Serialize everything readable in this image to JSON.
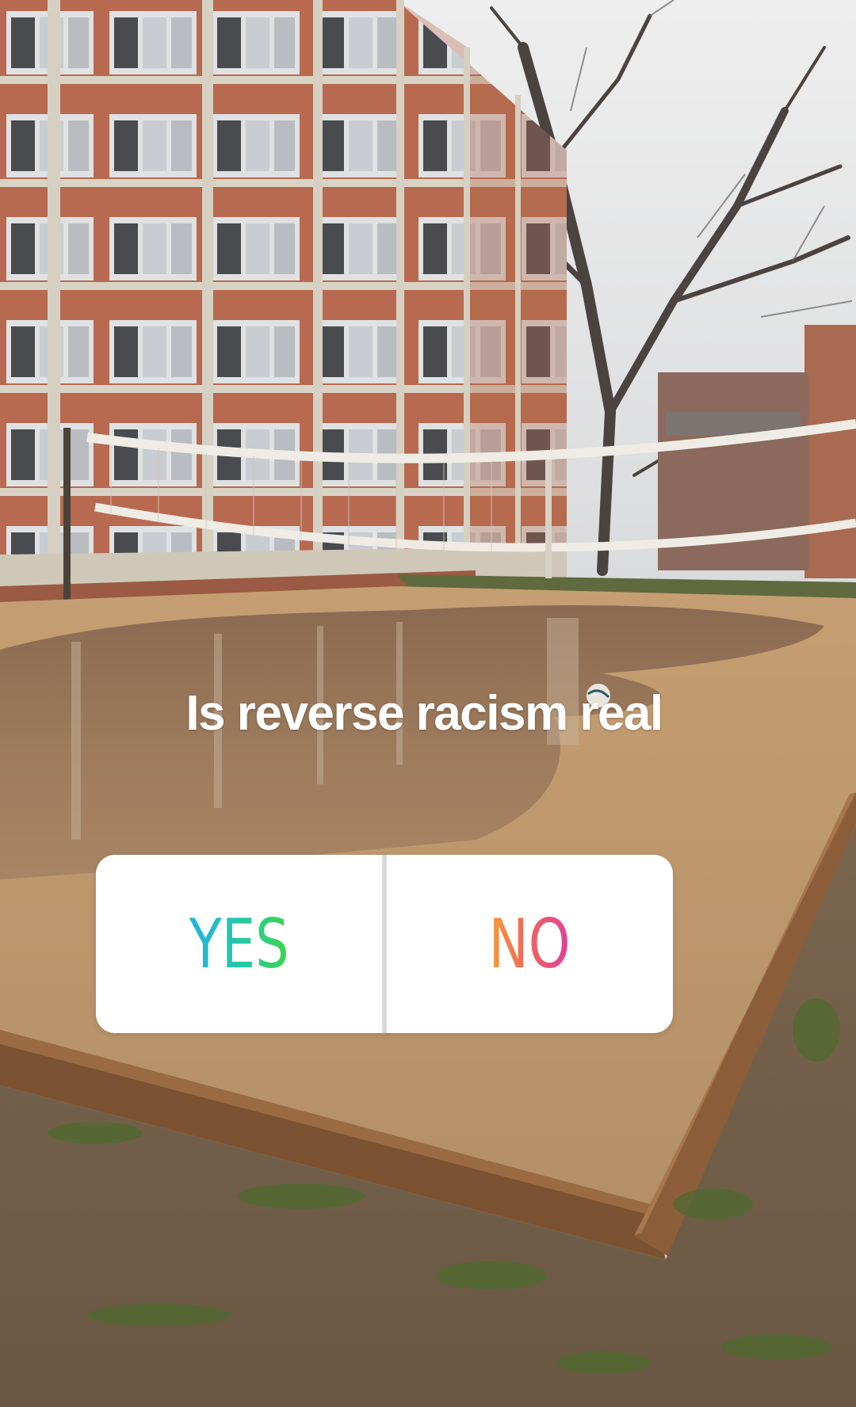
{
  "story": {
    "question": "Is reverse racism real"
  },
  "poll": {
    "yes_label": "YES",
    "no_label": "NO"
  },
  "colors": {
    "yes_gradient": [
      "#20b4e3",
      "#27c8a0",
      "#3bd64a"
    ],
    "no_gradient": [
      "#f59e3b",
      "#f0645f",
      "#e23e9b"
    ],
    "poll_background": "#ffffff",
    "question_text": "#ffffff"
  },
  "background_photo": {
    "subject": "sand volleyball court with puddle in front of brick building"
  }
}
